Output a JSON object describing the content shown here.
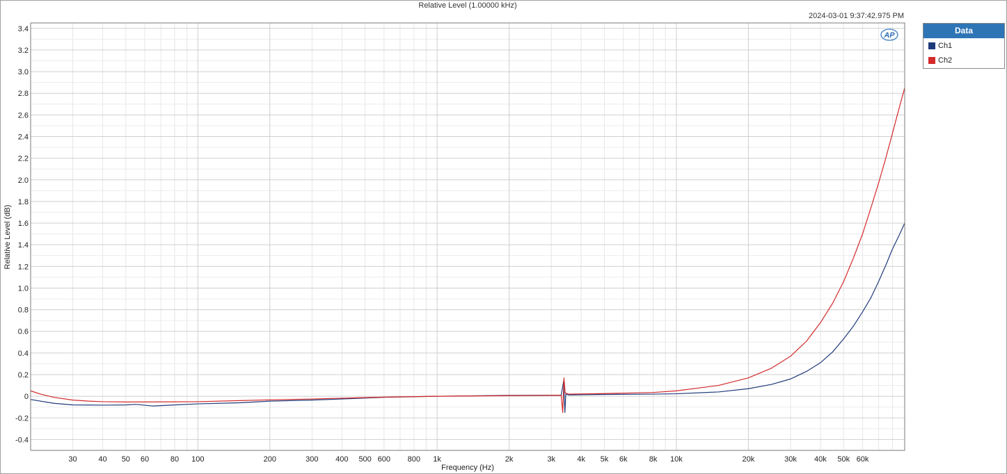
{
  "chart_data": {
    "type": "line",
    "title": "Relative Level (1.00000 kHz)",
    "timestamp": "2024-03-01 9:37:42.975 PM",
    "xlabel": "Frequency (Hz)",
    "ylabel": "Relative Level (dB)",
    "x_scale": "log",
    "xlim": [
      20,
      90000
    ],
    "ylim": [
      -0.5,
      3.45
    ],
    "grid": true,
    "legend_title": "Data",
    "legend_position": "right-outside",
    "x_ticks": [
      {
        "v": 30,
        "label": "30"
      },
      {
        "v": 40,
        "label": "40"
      },
      {
        "v": 50,
        "label": "50"
      },
      {
        "v": 60,
        "label": "60"
      },
      {
        "v": 80,
        "label": "80"
      },
      {
        "v": 100,
        "label": "100"
      },
      {
        "v": 200,
        "label": "200"
      },
      {
        "v": 300,
        "label": "300"
      },
      {
        "v": 400,
        "label": "400"
      },
      {
        "v": 500,
        "label": "500"
      },
      {
        "v": 600,
        "label": "600"
      },
      {
        "v": 800,
        "label": "800"
      },
      {
        "v": 1000,
        "label": "1k"
      },
      {
        "v": 2000,
        "label": "2k"
      },
      {
        "v": 3000,
        "label": "3k"
      },
      {
        "v": 4000,
        "label": "4k"
      },
      {
        "v": 5000,
        "label": "5k"
      },
      {
        "v": 6000,
        "label": "6k"
      },
      {
        "v": 8000,
        "label": "8k"
      },
      {
        "v": 10000,
        "label": "10k"
      },
      {
        "v": 20000,
        "label": "20k"
      },
      {
        "v": 30000,
        "label": "30k"
      },
      {
        "v": 40000,
        "label": "40k"
      },
      {
        "v": 50000,
        "label": "50k"
      },
      {
        "v": 60000,
        "label": "60k"
      }
    ],
    "y_ticks": [
      {
        "v": -0.4,
        "label": "-0.4"
      },
      {
        "v": -0.2,
        "label": "-0.2"
      },
      {
        "v": 0,
        "label": "0"
      },
      {
        "v": 0.2,
        "label": "0.2"
      },
      {
        "v": 0.4,
        "label": "0.4"
      },
      {
        "v": 0.6,
        "label": "0.6"
      },
      {
        "v": 0.8,
        "label": "0.8"
      },
      {
        "v": 1.0,
        "label": "1.0"
      },
      {
        "v": 1.2,
        "label": "1.2"
      },
      {
        "v": 1.4,
        "label": "1.4"
      },
      {
        "v": 1.6,
        "label": "1.6"
      },
      {
        "v": 1.8,
        "label": "1.8"
      },
      {
        "v": 2.0,
        "label": "2.0"
      },
      {
        "v": 2.2,
        "label": "2.2"
      },
      {
        "v": 2.4,
        "label": "2.4"
      },
      {
        "v": 2.6,
        "label": "2.6"
      },
      {
        "v": 2.8,
        "label": "2.8"
      },
      {
        "v": 3.0,
        "label": "3.0"
      },
      {
        "v": 3.2,
        "label": "3.2"
      },
      {
        "v": 3.4,
        "label": "3.4"
      }
    ],
    "series": [
      {
        "name": "Ch1",
        "color": "#1f3a7a",
        "points": [
          [
            20,
            -0.03
          ],
          [
            25,
            -0.065
          ],
          [
            30,
            -0.08
          ],
          [
            40,
            -0.082
          ],
          [
            50,
            -0.08
          ],
          [
            55,
            -0.075
          ],
          [
            65,
            -0.09
          ],
          [
            80,
            -0.08
          ],
          [
            100,
            -0.07
          ],
          [
            150,
            -0.06
          ],
          [
            200,
            -0.045
          ],
          [
            300,
            -0.035
          ],
          [
            400,
            -0.025
          ],
          [
            600,
            -0.01
          ],
          [
            1000,
            0
          ],
          [
            2000,
            0.008
          ],
          [
            3000,
            0.01
          ],
          [
            3300,
            0.01
          ],
          [
            3380,
            0.14
          ],
          [
            3420,
            -0.15
          ],
          [
            3450,
            0.02
          ],
          [
            3550,
            0.012
          ],
          [
            5000,
            0.017
          ],
          [
            8000,
            0.02
          ],
          [
            10000,
            0.023
          ],
          [
            15000,
            0.04
          ],
          [
            20000,
            0.07
          ],
          [
            25000,
            0.11
          ],
          [
            30000,
            0.16
          ],
          [
            35000,
            0.23
          ],
          [
            40000,
            0.31
          ],
          [
            45000,
            0.41
          ],
          [
            50000,
            0.53
          ],
          [
            55000,
            0.65
          ],
          [
            60000,
            0.78
          ],
          [
            65000,
            0.91
          ],
          [
            70000,
            1.06
          ],
          [
            75000,
            1.21
          ],
          [
            80000,
            1.36
          ],
          [
            85000,
            1.48
          ],
          [
            90000,
            1.6
          ]
        ]
      },
      {
        "name": "Ch2",
        "color": "#d42a2a",
        "points": [
          [
            20,
            0.05
          ],
          [
            22,
            0.02
          ],
          [
            25,
            -0.01
          ],
          [
            30,
            -0.035
          ],
          [
            35,
            -0.045
          ],
          [
            40,
            -0.05
          ],
          [
            50,
            -0.053
          ],
          [
            70,
            -0.052
          ],
          [
            100,
            -0.05
          ],
          [
            150,
            -0.04
          ],
          [
            200,
            -0.033
          ],
          [
            300,
            -0.025
          ],
          [
            400,
            -0.018
          ],
          [
            600,
            -0.008
          ],
          [
            1000,
            0
          ],
          [
            2000,
            0.006
          ],
          [
            3000,
            0.008
          ],
          [
            3300,
            0.009
          ],
          [
            3350,
            -0.15
          ],
          [
            3390,
            0.17
          ],
          [
            3430,
            0.03
          ],
          [
            3550,
            0.02
          ],
          [
            5000,
            0.025
          ],
          [
            8000,
            0.035
          ],
          [
            10000,
            0.05
          ],
          [
            15000,
            0.1
          ],
          [
            20000,
            0.17
          ],
          [
            25000,
            0.26
          ],
          [
            30000,
            0.37
          ],
          [
            35000,
            0.51
          ],
          [
            40000,
            0.68
          ],
          [
            45000,
            0.86
          ],
          [
            50000,
            1.06
          ],
          [
            55000,
            1.28
          ],
          [
            60000,
            1.5
          ],
          [
            65000,
            1.74
          ],
          [
            70000,
            1.97
          ],
          [
            75000,
            2.2
          ],
          [
            80000,
            2.43
          ],
          [
            85000,
            2.65
          ],
          [
            90000,
            2.85
          ]
        ]
      }
    ]
  }
}
